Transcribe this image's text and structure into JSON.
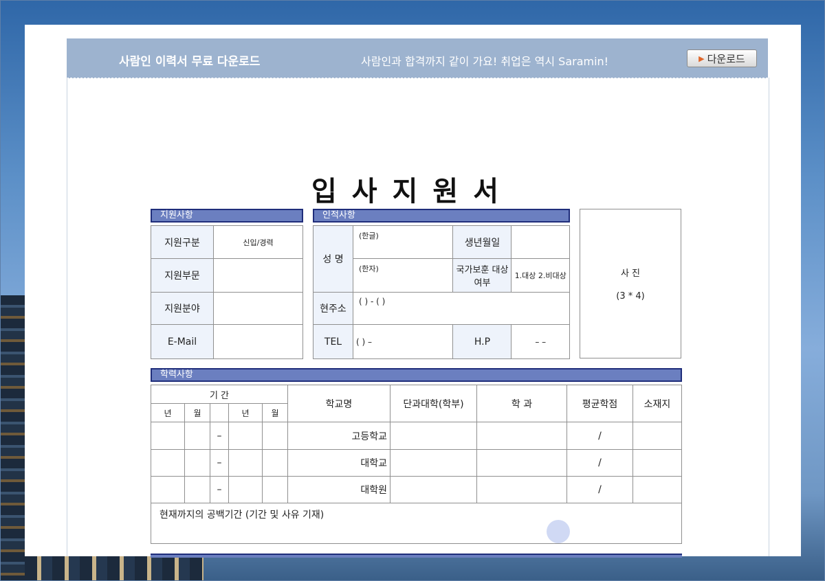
{
  "banner": {
    "title": "사람인 이력서 무료 다운로드",
    "subtitle": "사람인과 합격까지 같이 가요! 취업은 역시 Saramin!",
    "download_label": "다운로드"
  },
  "document": {
    "title": "입사지원서",
    "apply": {
      "header": "지원사항",
      "rows": [
        {
          "label": "지원구분",
          "value": "신입/경력"
        },
        {
          "label": "지원부문",
          "value": ""
        },
        {
          "label": "지원분야",
          "value": ""
        },
        {
          "label": "E-Mail",
          "value": ""
        }
      ]
    },
    "personal": {
      "header": "인적사항",
      "name_label": "성 명",
      "name_korean_hint": "(한글)",
      "name_hanja_hint": "(한자)",
      "birth_label": "생년월일",
      "veteran_label": "국가보훈 대상여부",
      "veteran_value": "1.대상 2.비대상",
      "address_label": "현주소",
      "address_value": "(      ) - (      )",
      "tel_label": "TEL",
      "tel_value": "(   )      –",
      "hp_label": "H.P",
      "hp_value": "–      –"
    },
    "photo": {
      "label": "사 진",
      "size": "(3 * 4)"
    },
    "education": {
      "header": "학력사항",
      "period_label": "기 간",
      "year_label": "년",
      "month_label": "월",
      "columns": [
        "학교명",
        "단과대학(학부)",
        "학 과",
        "평균학점",
        "소재지"
      ],
      "rows": [
        {
          "dash": "–",
          "school": "고등학교",
          "gpa": "/"
        },
        {
          "dash": "–",
          "school": "대학교",
          "gpa": "/"
        },
        {
          "dash": "–",
          "school": "대학원",
          "gpa": "/"
        }
      ],
      "gap_note": "현재까지의 공백기간 (기간 및 사유 기재)"
    }
  }
}
